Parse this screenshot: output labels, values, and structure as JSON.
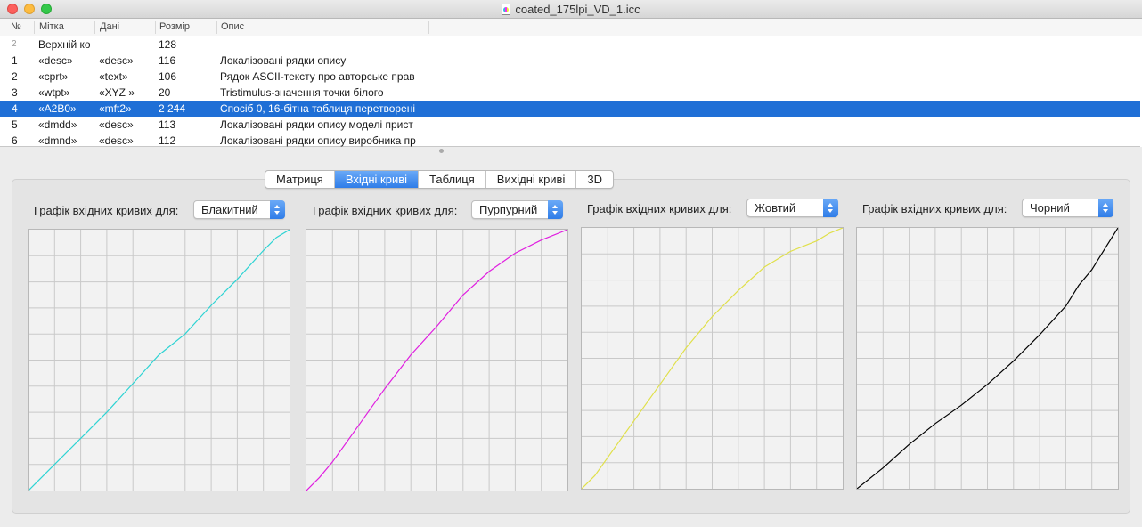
{
  "window": {
    "title": "coated_175lpi_VD_1.icc"
  },
  "table": {
    "columns": [
      "№",
      "Мітка",
      "Дані",
      "Розмір",
      "Опис"
    ],
    "rows": [
      {
        "num": "2",
        "tag": "Верхній ко",
        "data": "",
        "size": "128",
        "desc": "",
        "muted": true
      },
      {
        "num": "1",
        "tag": "«desc»",
        "data": "«desc»",
        "size": "116",
        "desc": "Локалізовані рядки опису"
      },
      {
        "num": "2",
        "tag": "«cprt»",
        "data": "«text»",
        "size": "106",
        "desc": "Рядок ASCII-тексту про авторське прав"
      },
      {
        "num": "3",
        "tag": "«wtpt»",
        "data": "«XYZ »",
        "size": "20",
        "desc": "Tristimulus-значення точки білого"
      },
      {
        "num": "4",
        "tag": "«A2B0»",
        "data": "«mft2»",
        "size": "2 244",
        "desc": "Спосіб 0, 16-бітна таблиця перетворені",
        "selected": true
      },
      {
        "num": "5",
        "tag": "«dmdd»",
        "data": "«desc»",
        "size": "113",
        "desc": "Локалізовані рядки опису моделі прист"
      },
      {
        "num": "6",
        "tag": "«dmnd»",
        "data": "«desc»",
        "size": "112",
        "desc": "Локалізовані рядки опису виробника пр"
      }
    ]
  },
  "tabs": [
    {
      "label": "Матриця",
      "active": false
    },
    {
      "label": "Вхідні криві",
      "active": true
    },
    {
      "label": "Таблиця",
      "active": false
    },
    {
      "label": "Вихідні криві",
      "active": false
    },
    {
      "label": "3D",
      "active": false
    }
  ],
  "curve_label": "Графік вхідних кривих для:",
  "graphs": [
    {
      "channel": "Блакитний",
      "color": "#2ed3d3"
    },
    {
      "channel": "Пурпурний",
      "color": "#e01ee0"
    },
    {
      "channel": "Жовтий",
      "color": "#e0e04a"
    },
    {
      "channel": "Чорний",
      "color": "#000000"
    }
  ],
  "chart_data": [
    {
      "type": "line",
      "title": "",
      "xlim": [
        0,
        1
      ],
      "ylim": [
        0,
        1
      ],
      "grid": true,
      "series": [
        {
          "color": "#2ed3d3",
          "x": [
            0,
            0.1,
            0.2,
            0.3,
            0.4,
            0.5,
            0.6,
            0.7,
            0.8,
            0.9,
            0.95,
            1
          ],
          "y": [
            0,
            0.1,
            0.2,
            0.3,
            0.41,
            0.52,
            0.6,
            0.71,
            0.81,
            0.92,
            0.97,
            1
          ]
        }
      ]
    },
    {
      "type": "line",
      "title": "",
      "xlim": [
        0,
        1
      ],
      "ylim": [
        0,
        1
      ],
      "grid": true,
      "series": [
        {
          "color": "#e01ee0",
          "x": [
            0,
            0.05,
            0.1,
            0.2,
            0.3,
            0.4,
            0.5,
            0.6,
            0.7,
            0.8,
            0.9,
            1
          ],
          "y": [
            0,
            0.05,
            0.11,
            0.25,
            0.39,
            0.52,
            0.63,
            0.75,
            0.84,
            0.91,
            0.96,
            1
          ]
        }
      ]
    },
    {
      "type": "line",
      "title": "",
      "xlim": [
        0,
        1
      ],
      "ylim": [
        0,
        1
      ],
      "grid": true,
      "series": [
        {
          "color": "#e0e04a",
          "x": [
            0,
            0.05,
            0.1,
            0.2,
            0.3,
            0.4,
            0.5,
            0.6,
            0.7,
            0.8,
            0.9,
            0.95,
            1
          ],
          "y": [
            0,
            0.05,
            0.12,
            0.26,
            0.4,
            0.54,
            0.66,
            0.76,
            0.85,
            0.91,
            0.95,
            0.98,
            1
          ]
        }
      ]
    },
    {
      "type": "line",
      "title": "",
      "xlim": [
        0,
        1
      ],
      "ylim": [
        0,
        1
      ],
      "grid": true,
      "series": [
        {
          "color": "#000000",
          "x": [
            0,
            0.1,
            0.2,
            0.3,
            0.4,
            0.5,
            0.6,
            0.7,
            0.8,
            0.85,
            0.9,
            0.95,
            1
          ],
          "y": [
            0,
            0.08,
            0.17,
            0.25,
            0.32,
            0.4,
            0.49,
            0.59,
            0.7,
            0.78,
            0.84,
            0.92,
            1
          ]
        }
      ]
    }
  ]
}
